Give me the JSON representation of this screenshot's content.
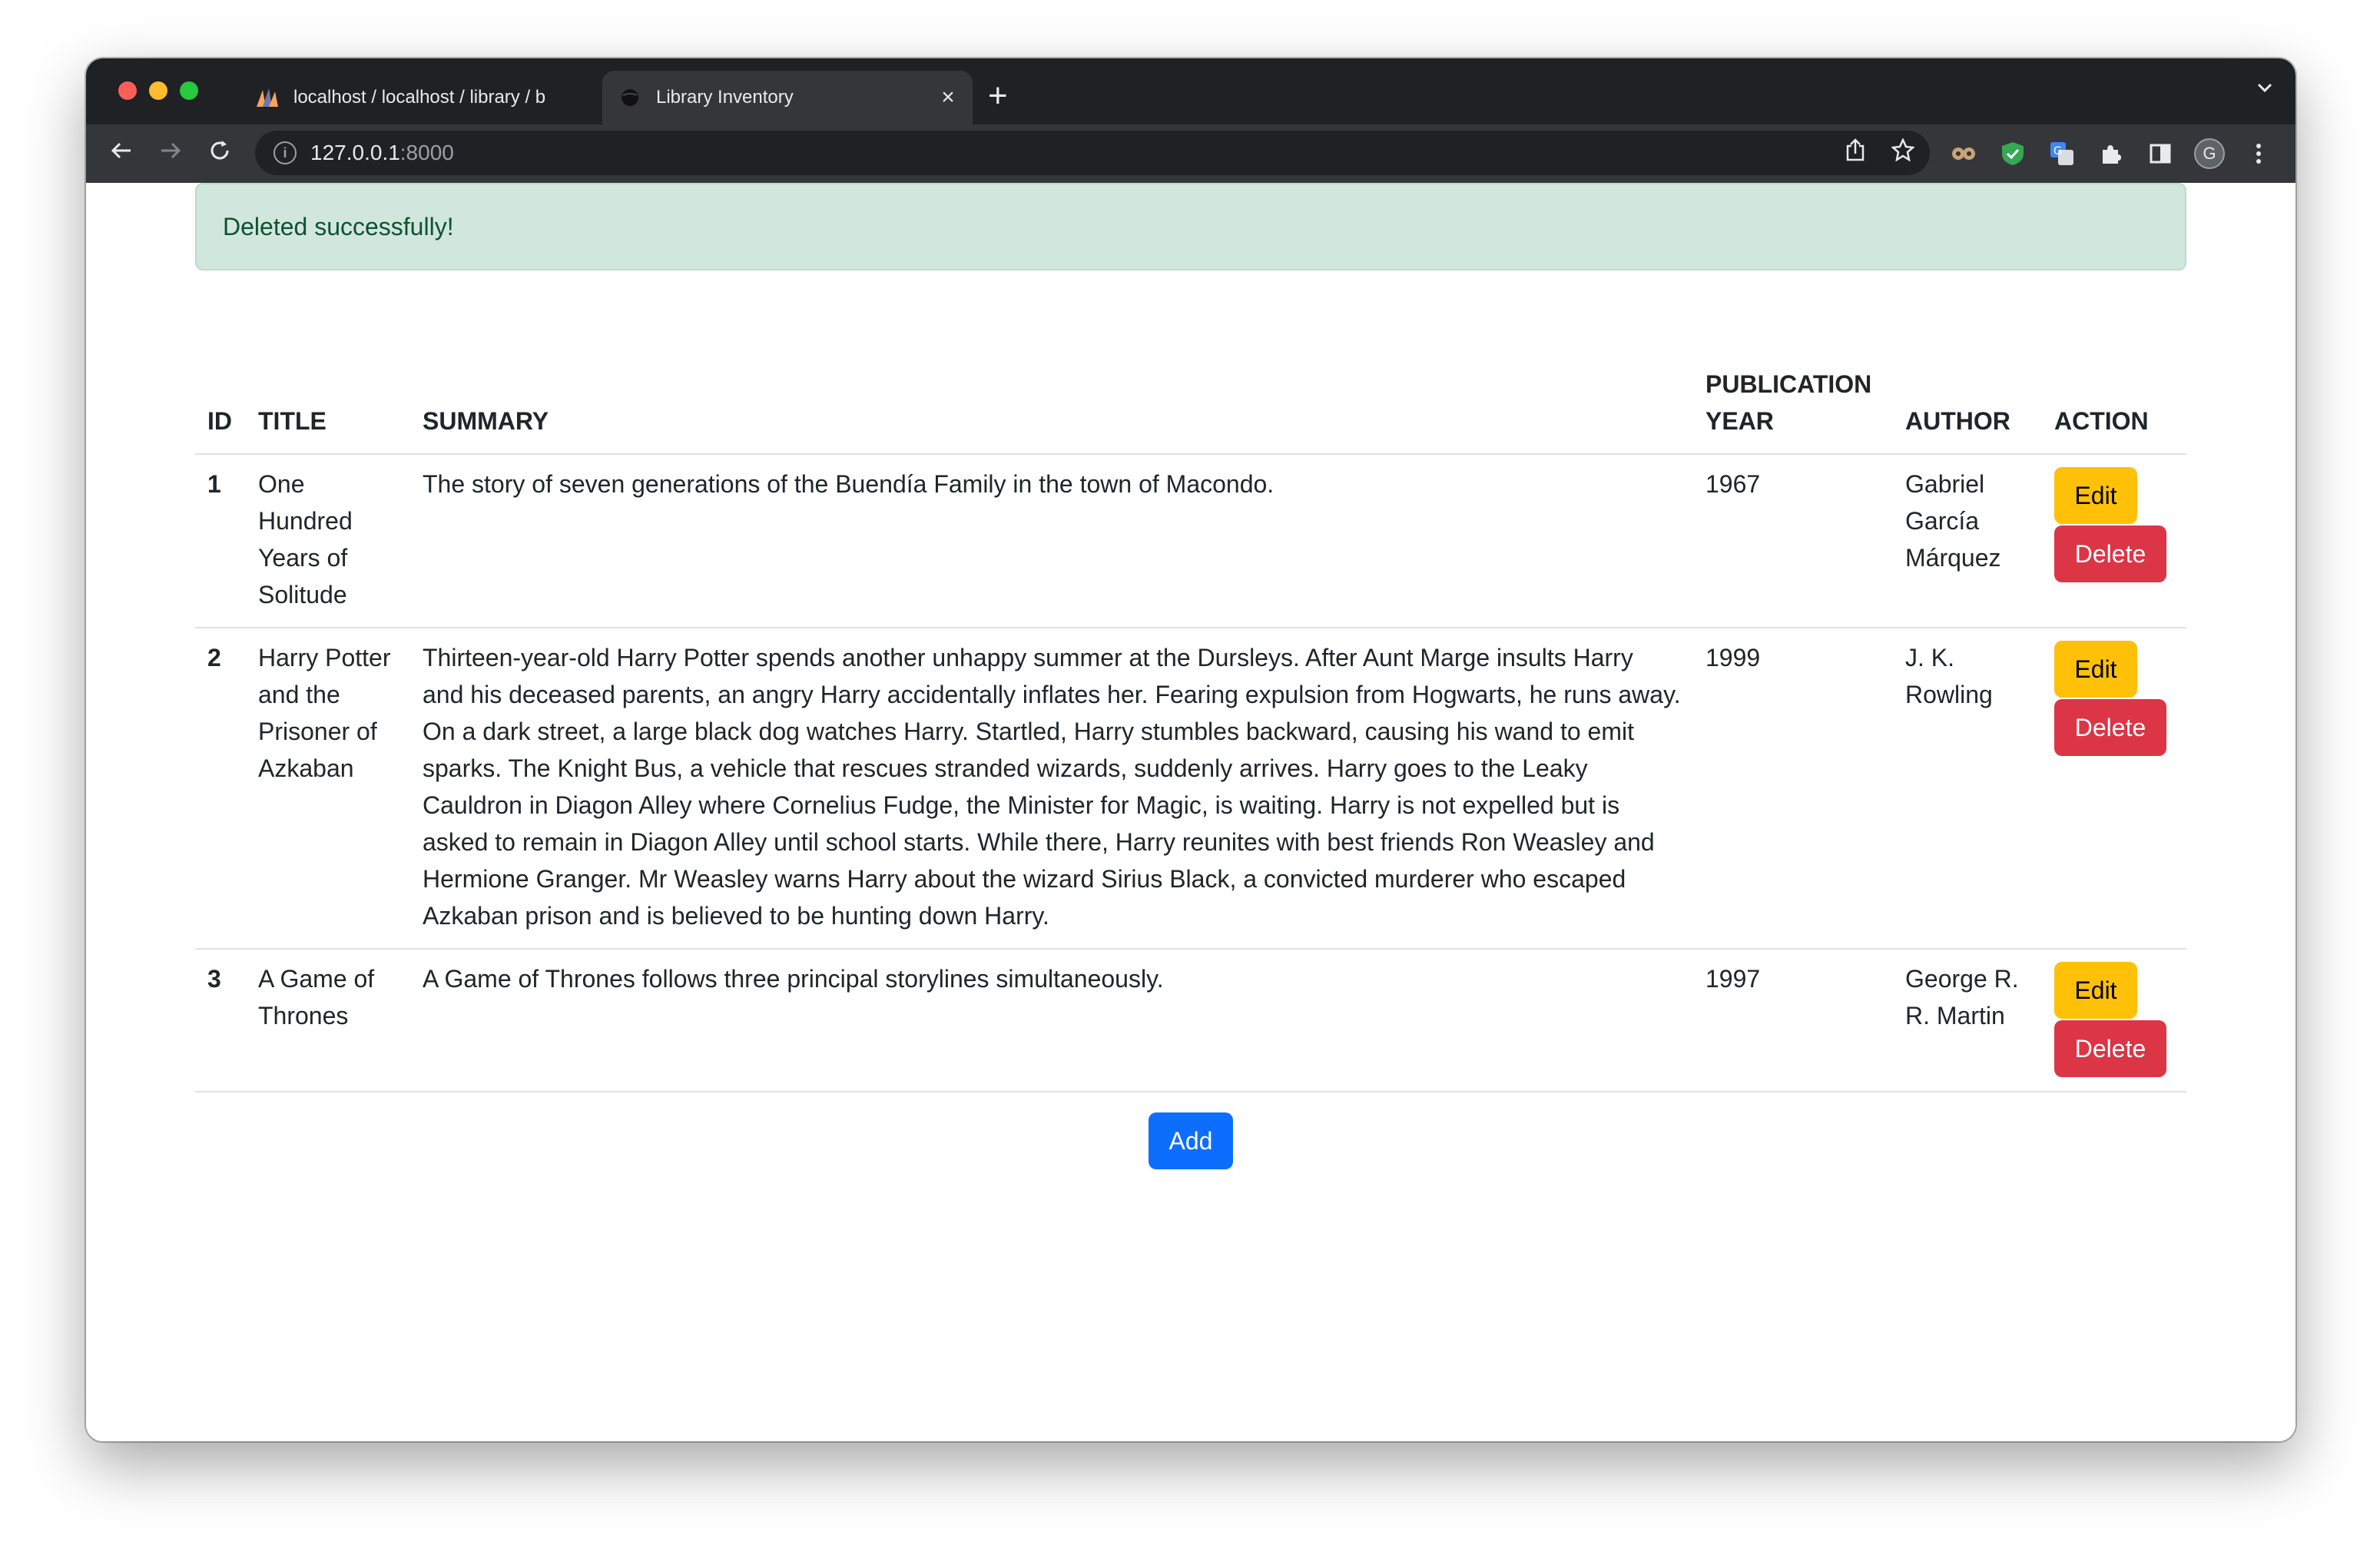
{
  "browser": {
    "tabs": [
      {
        "title": "localhost / localhost / library / b",
        "favicon": "phpmyadmin-icon"
      },
      {
        "title": "Library Inventory",
        "favicon": "globe-icon"
      }
    ],
    "url_host": "127.0.0.1",
    "url_port": ":8000",
    "avatar_initial": "G"
  },
  "alert": {
    "message": "Deleted successfully!"
  },
  "table": {
    "headers": {
      "id": "ID",
      "title": "TITLE",
      "summary": "SUMMARY",
      "year_line1": "PUBLICATION",
      "year_line2": "YEAR",
      "author": "AUTHOR",
      "action": "ACTION"
    },
    "rows": [
      {
        "id": "1",
        "title": "One Hundred Years of Solitude",
        "summary": "The story of seven generations of the Buendía Family in the town of Macondo.",
        "year": "1967",
        "author": "Gabriel García Márquez"
      },
      {
        "id": "2",
        "title": "Harry Potter and the Prisoner of Azkaban",
        "summary": "Thirteen-year-old Harry Potter spends another unhappy summer at the Dursleys. After Aunt Marge insults Harry and his deceased parents, an angry Harry accidentally inflates her. Fearing expulsion from Hogwarts, he runs away. On a dark street, a large black dog watches Harry. Startled, Harry stumbles backward, causing his wand to emit sparks. The Knight Bus, a vehicle that rescues stranded wizards, suddenly arrives. Harry goes to the Leaky Cauldron in Diagon Alley where Cornelius Fudge, the Minister for Magic, is waiting. Harry is not expelled but is asked to remain in Diagon Alley until school starts. While there, Harry reunites with best friends Ron Weasley and Hermione Granger. Mr Weasley warns Harry about the wizard Sirius Black, a convicted murderer who escaped Azkaban prison and is believed to be hunting down Harry.",
        "year": "1999",
        "author": "J. K. Rowling"
      },
      {
        "id": "3",
        "title": "A Game of Thrones",
        "summary": "A Game of Thrones follows three principal storylines simultaneously.",
        "year": "1997",
        "author": "George R. R. Martin"
      }
    ],
    "edit_label": "Edit",
    "delete_label": "Delete"
  },
  "add_label": "Add",
  "colors": {
    "edit": "#ffc107",
    "delete": "#dc3545",
    "add": "#0d6efd",
    "alert_bg": "#d1e7dd"
  }
}
